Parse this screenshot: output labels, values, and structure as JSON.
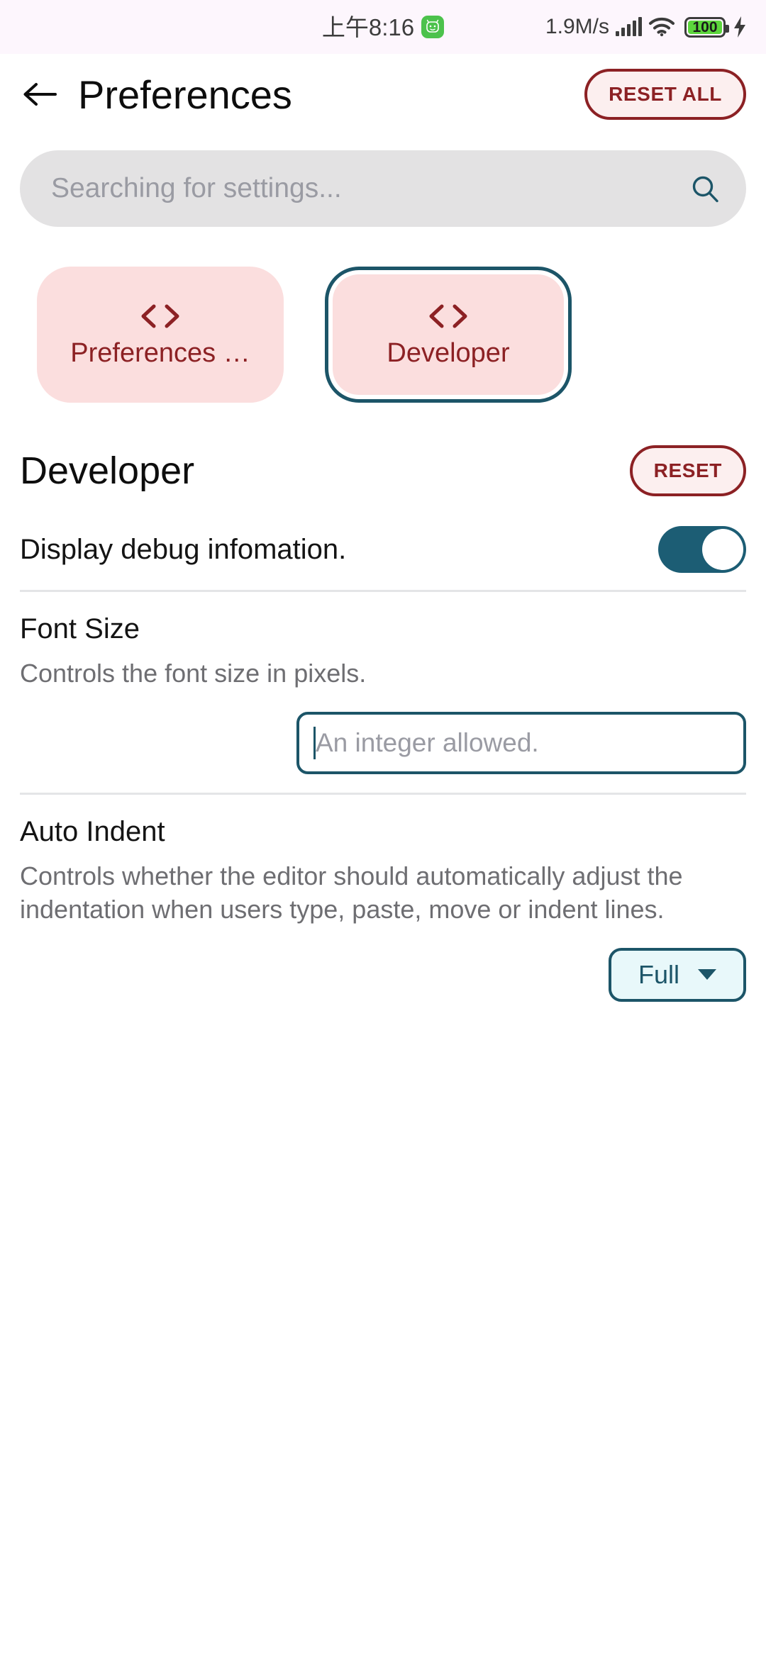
{
  "status_bar": {
    "time": "上午8:16",
    "app_badge_icon": "app-notification-icon",
    "network_speed": "1.9M/s",
    "signal_icon": "cellular-signal-icon",
    "wifi_icon": "wifi-icon",
    "battery_level": "100",
    "charging_icon": "lightning-bolt-icon",
    "background": "#FDF6FD"
  },
  "header": {
    "back_icon": "arrow-left-icon",
    "title": "Preferences",
    "reset_all_label": "RESET ALL",
    "accent": "#8C2124"
  },
  "search": {
    "placeholder": "Searching for settings...",
    "value": "",
    "icon": "search-icon",
    "icon_color": "#1C5568",
    "background": "#E3E2E3"
  },
  "chips": [
    {
      "label": "Preferences …",
      "icon": "code-brackets-icon",
      "selected": false
    },
    {
      "label": "Developer",
      "icon": "code-brackets-icon",
      "selected": true
    }
  ],
  "section": {
    "title": "Developer",
    "reset_label": "RESET"
  },
  "settings": [
    {
      "type": "switch",
      "label": "Display debug infomation.",
      "value": "on"
    },
    {
      "type": "text",
      "title": "Font Size",
      "description": "Controls the font size in pixels.",
      "placeholder": "An integer allowed.",
      "value": ""
    },
    {
      "type": "select",
      "title": "Auto Indent",
      "description": "Controls whether the editor should automatically adjust the indentation when users type, paste, move or indent lines.",
      "value": "Full",
      "caret_icon": "chevron-down-icon"
    }
  ],
  "theme": {
    "teal": "#1C5568",
    "teal_track": "#1C5D74",
    "chip_pink": "#FBDEDE",
    "dark_red": "#8C2124",
    "divider": "#E4E5E7"
  }
}
